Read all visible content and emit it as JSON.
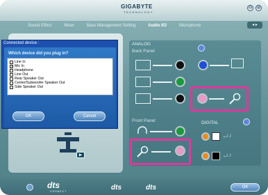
{
  "app": {
    "brand": "GIGABYTE",
    "brand_sub": "TECHNOLOGY"
  },
  "window": {
    "minimize_glyph": "⊖",
    "close_glyph": "⊗"
  },
  "tabs": [
    {
      "label": "Sound Effect"
    },
    {
      "label": "Mixer"
    },
    {
      "label": "Bass Management Setting"
    },
    {
      "label": "Audio I/O",
      "active": true
    },
    {
      "label": "Microphone"
    }
  ],
  "tab_nav_label": "◂ ▸",
  "dialog": {
    "title": "Connected device :",
    "question": "Which device did you plug in?",
    "options": [
      {
        "label": "Line In",
        "checked": false
      },
      {
        "label": "Mic In",
        "checked": true
      },
      {
        "label": "Headphone",
        "checked": false
      },
      {
        "label": "Line Out",
        "checked": false
      },
      {
        "label": "Rear Speaker Out",
        "checked": false
      },
      {
        "label": "Center/Subwoofer Speaker Out",
        "checked": false
      },
      {
        "label": "Side Speaker Out",
        "checked": false
      }
    ],
    "ok_label": "OK",
    "cancel_label": "Cancel"
  },
  "panel": {
    "analog": "ANALOG",
    "back_panel": "Back Panel",
    "front_panel": "Front Panel",
    "digital": "DIGITAL"
  },
  "jack_colors": {
    "black": "#111111",
    "blue": "#1f4fd4",
    "green": "#1a9a3a",
    "pink": "#e79ac4",
    "orange": "#f08a1c"
  },
  "highlight_color": "#e0379d",
  "footer": {
    "dts_label": "dts",
    "dts_sub": "CONNECT",
    "ok_label": "OK"
  }
}
